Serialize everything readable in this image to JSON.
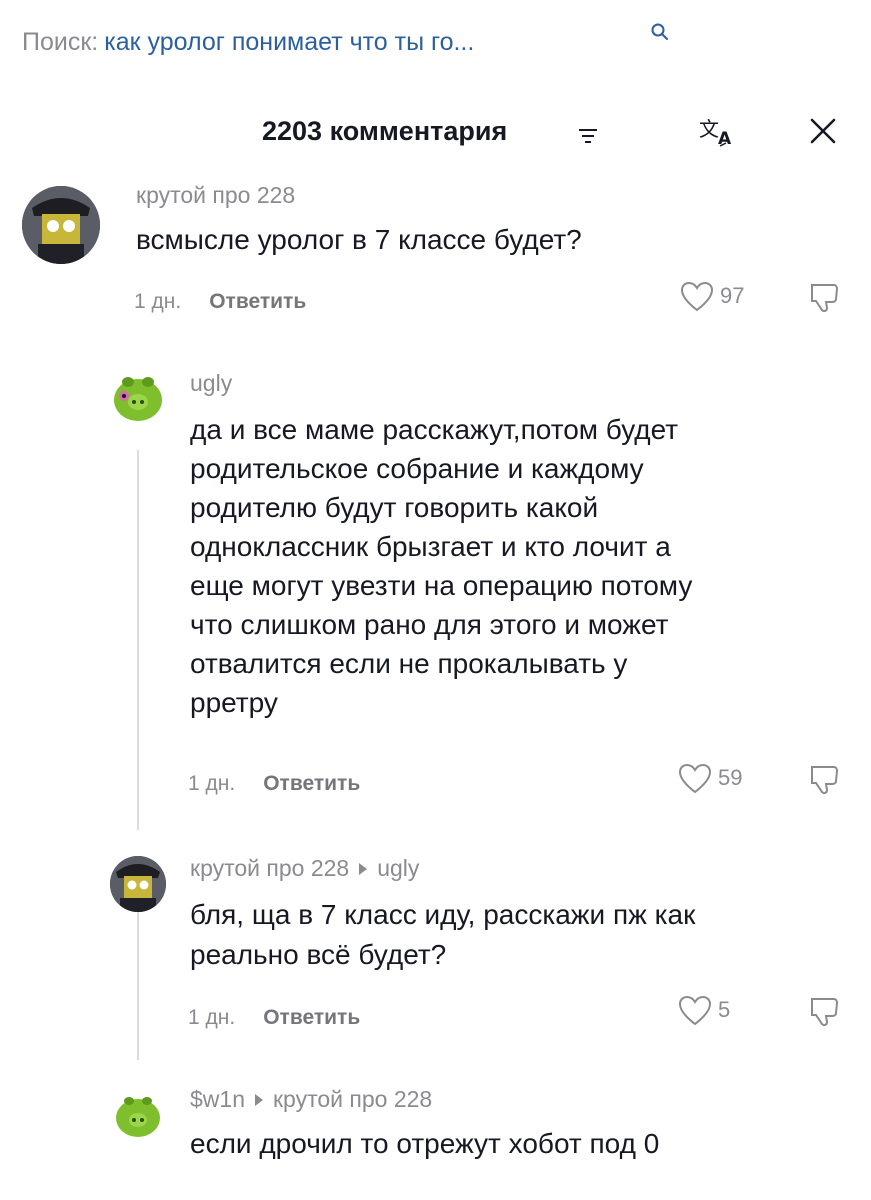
{
  "search": {
    "prefix": "Поиск:",
    "query": "как уролог понимает что ты го..."
  },
  "header": {
    "comment_count": "2203 комментария"
  },
  "comments": [
    {
      "author": "крутой про 228",
      "text": [
        "всмысле уролог в 7 классе будет?"
      ],
      "time": "1 дн.",
      "reply_label": "Ответить",
      "likes": "97"
    },
    {
      "author": "ugly",
      "text": [
        "да и все маме расскажут,потом будет",
        "родительское собрание и каждому",
        "родителю будут говорить какой",
        "одноклассник брызгает и кто лочит а",
        "еще могут увезти на операцию потому",
        "что слишком рано для этого и может",
        "отвалится если не прокалывать у",
        "рретру"
      ],
      "time": "1 дн.",
      "reply_label": "Ответить",
      "likes": "59"
    },
    {
      "author": "крутой про 228",
      "reply_to": "ugly",
      "text": [
        "бля, ща в 7 класс иду, расскажи пж как",
        "реально всё будет?"
      ],
      "time": "1 дн.",
      "reply_label": "Ответить",
      "likes": "5"
    },
    {
      "author": "$w1n",
      "reply_to": "крутой про 228",
      "text": [
        "если дрочил то отрежут хобот под 0"
      ]
    }
  ]
}
